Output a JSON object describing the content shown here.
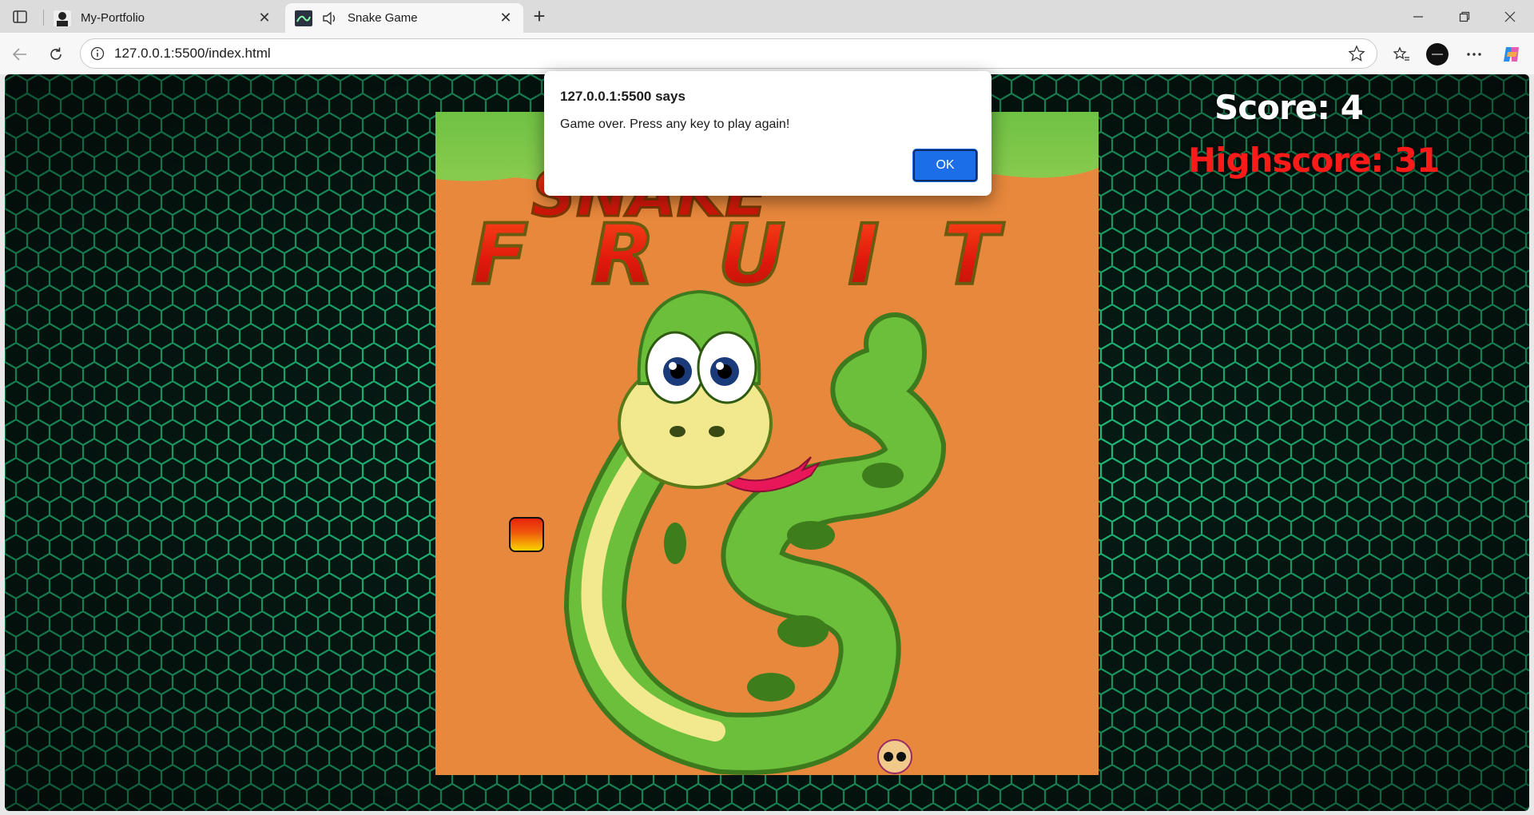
{
  "browser": {
    "tabs": [
      {
        "title": "My-Portfolio",
        "active": false
      },
      {
        "title": "Snake Game",
        "active": true
      }
    ],
    "url": "127.0.0.1:5500/index.html"
  },
  "game": {
    "score_text": "Score: 4",
    "highscore_text": "Highscore: 31",
    "logo_text": "SNAKE FRUIT",
    "colors": {
      "board": "#e8883d",
      "score": "#ffffff",
      "highscore": "#ff1a1a",
      "grass": "#7cc84a"
    }
  },
  "alert": {
    "title": "127.0.0.1:5500 says",
    "message": "Game over. Press any key to play again!",
    "ok_label": "OK"
  },
  "icons": {
    "sidebar": "sidebar-toggle-icon",
    "back": "back-arrow-icon",
    "reload": "reload-icon",
    "info": "info-icon",
    "favorite": "star-icon",
    "favorites_bar": "favorites-icon",
    "profile": "profile-icon",
    "menu": "more-icon",
    "copilot": "copilot-icon",
    "audio": "speaker-icon"
  }
}
